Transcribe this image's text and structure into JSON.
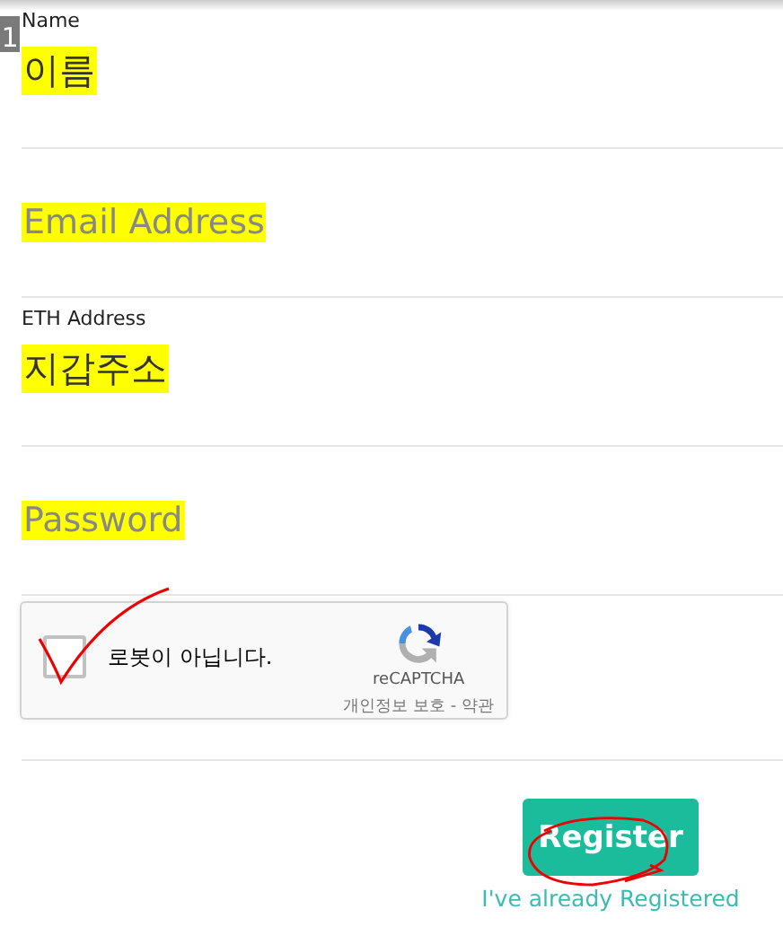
{
  "badge": "1",
  "fields": [
    {
      "label": "Name",
      "value": "이름",
      "highlighted": true
    },
    {
      "placeholder": "Email Address",
      "highlighted": true
    },
    {
      "label": "ETH Address",
      "value": "지갑주소",
      "highlighted": true
    },
    {
      "placeholder": "Password",
      "highlighted": true
    }
  ],
  "captcha": {
    "checked": false,
    "text": "로봇이 아닙니다.",
    "brand": "reCAPTCHA",
    "links": "개인정보 보호 - 약관"
  },
  "register_button": "Register",
  "login_link": "I've already Registered"
}
